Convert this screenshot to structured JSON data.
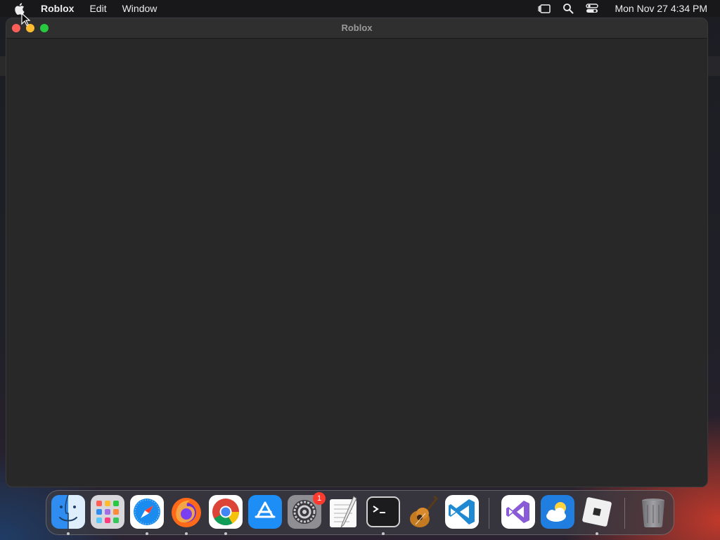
{
  "menubar": {
    "app_name": "Roblox",
    "items": [
      "Edit",
      "Window"
    ],
    "clock": "Mon Nov 27  4:34 PM",
    "status_icons": [
      "stage-manager-icon",
      "search-icon",
      "control-center-icon"
    ]
  },
  "window": {
    "title": "Roblox"
  },
  "dock": {
    "apps": [
      {
        "name": "Finder",
        "icon": "finder-icon",
        "running": true
      },
      {
        "name": "Launchpad",
        "icon": "launchpad-icon",
        "running": false
      },
      {
        "name": "Safari",
        "icon": "safari-icon",
        "running": true
      },
      {
        "name": "Firefox",
        "icon": "firefox-icon",
        "running": true
      },
      {
        "name": "Google Chrome",
        "icon": "chrome-icon",
        "running": true
      },
      {
        "name": "App Store",
        "icon": "app-store-icon",
        "running": false
      },
      {
        "name": "System Settings",
        "icon": "system-settings-icon",
        "running": false,
        "badge": "1"
      },
      {
        "name": "TextEdit",
        "icon": "textedit-icon",
        "running": false
      },
      {
        "name": "Terminal",
        "icon": "terminal-icon",
        "running": true
      },
      {
        "name": "GarageBand",
        "icon": "garageband-icon",
        "running": false
      },
      {
        "name": "Visual Studio Code",
        "icon": "vscode-icon",
        "running": false
      },
      {
        "name": "Visual Studio",
        "icon": "visual-studio-icon",
        "running": false
      },
      {
        "name": "Weather",
        "icon": "weather-icon",
        "running": false
      },
      {
        "name": "Roblox",
        "icon": "roblox-icon",
        "running": true
      },
      {
        "name": "Trash",
        "icon": "trash-icon",
        "running": false
      }
    ]
  },
  "colors": {
    "close": "#ff5f57",
    "minimize": "#febc2e",
    "zoom": "#28c840",
    "badge": "#ff3b30"
  }
}
